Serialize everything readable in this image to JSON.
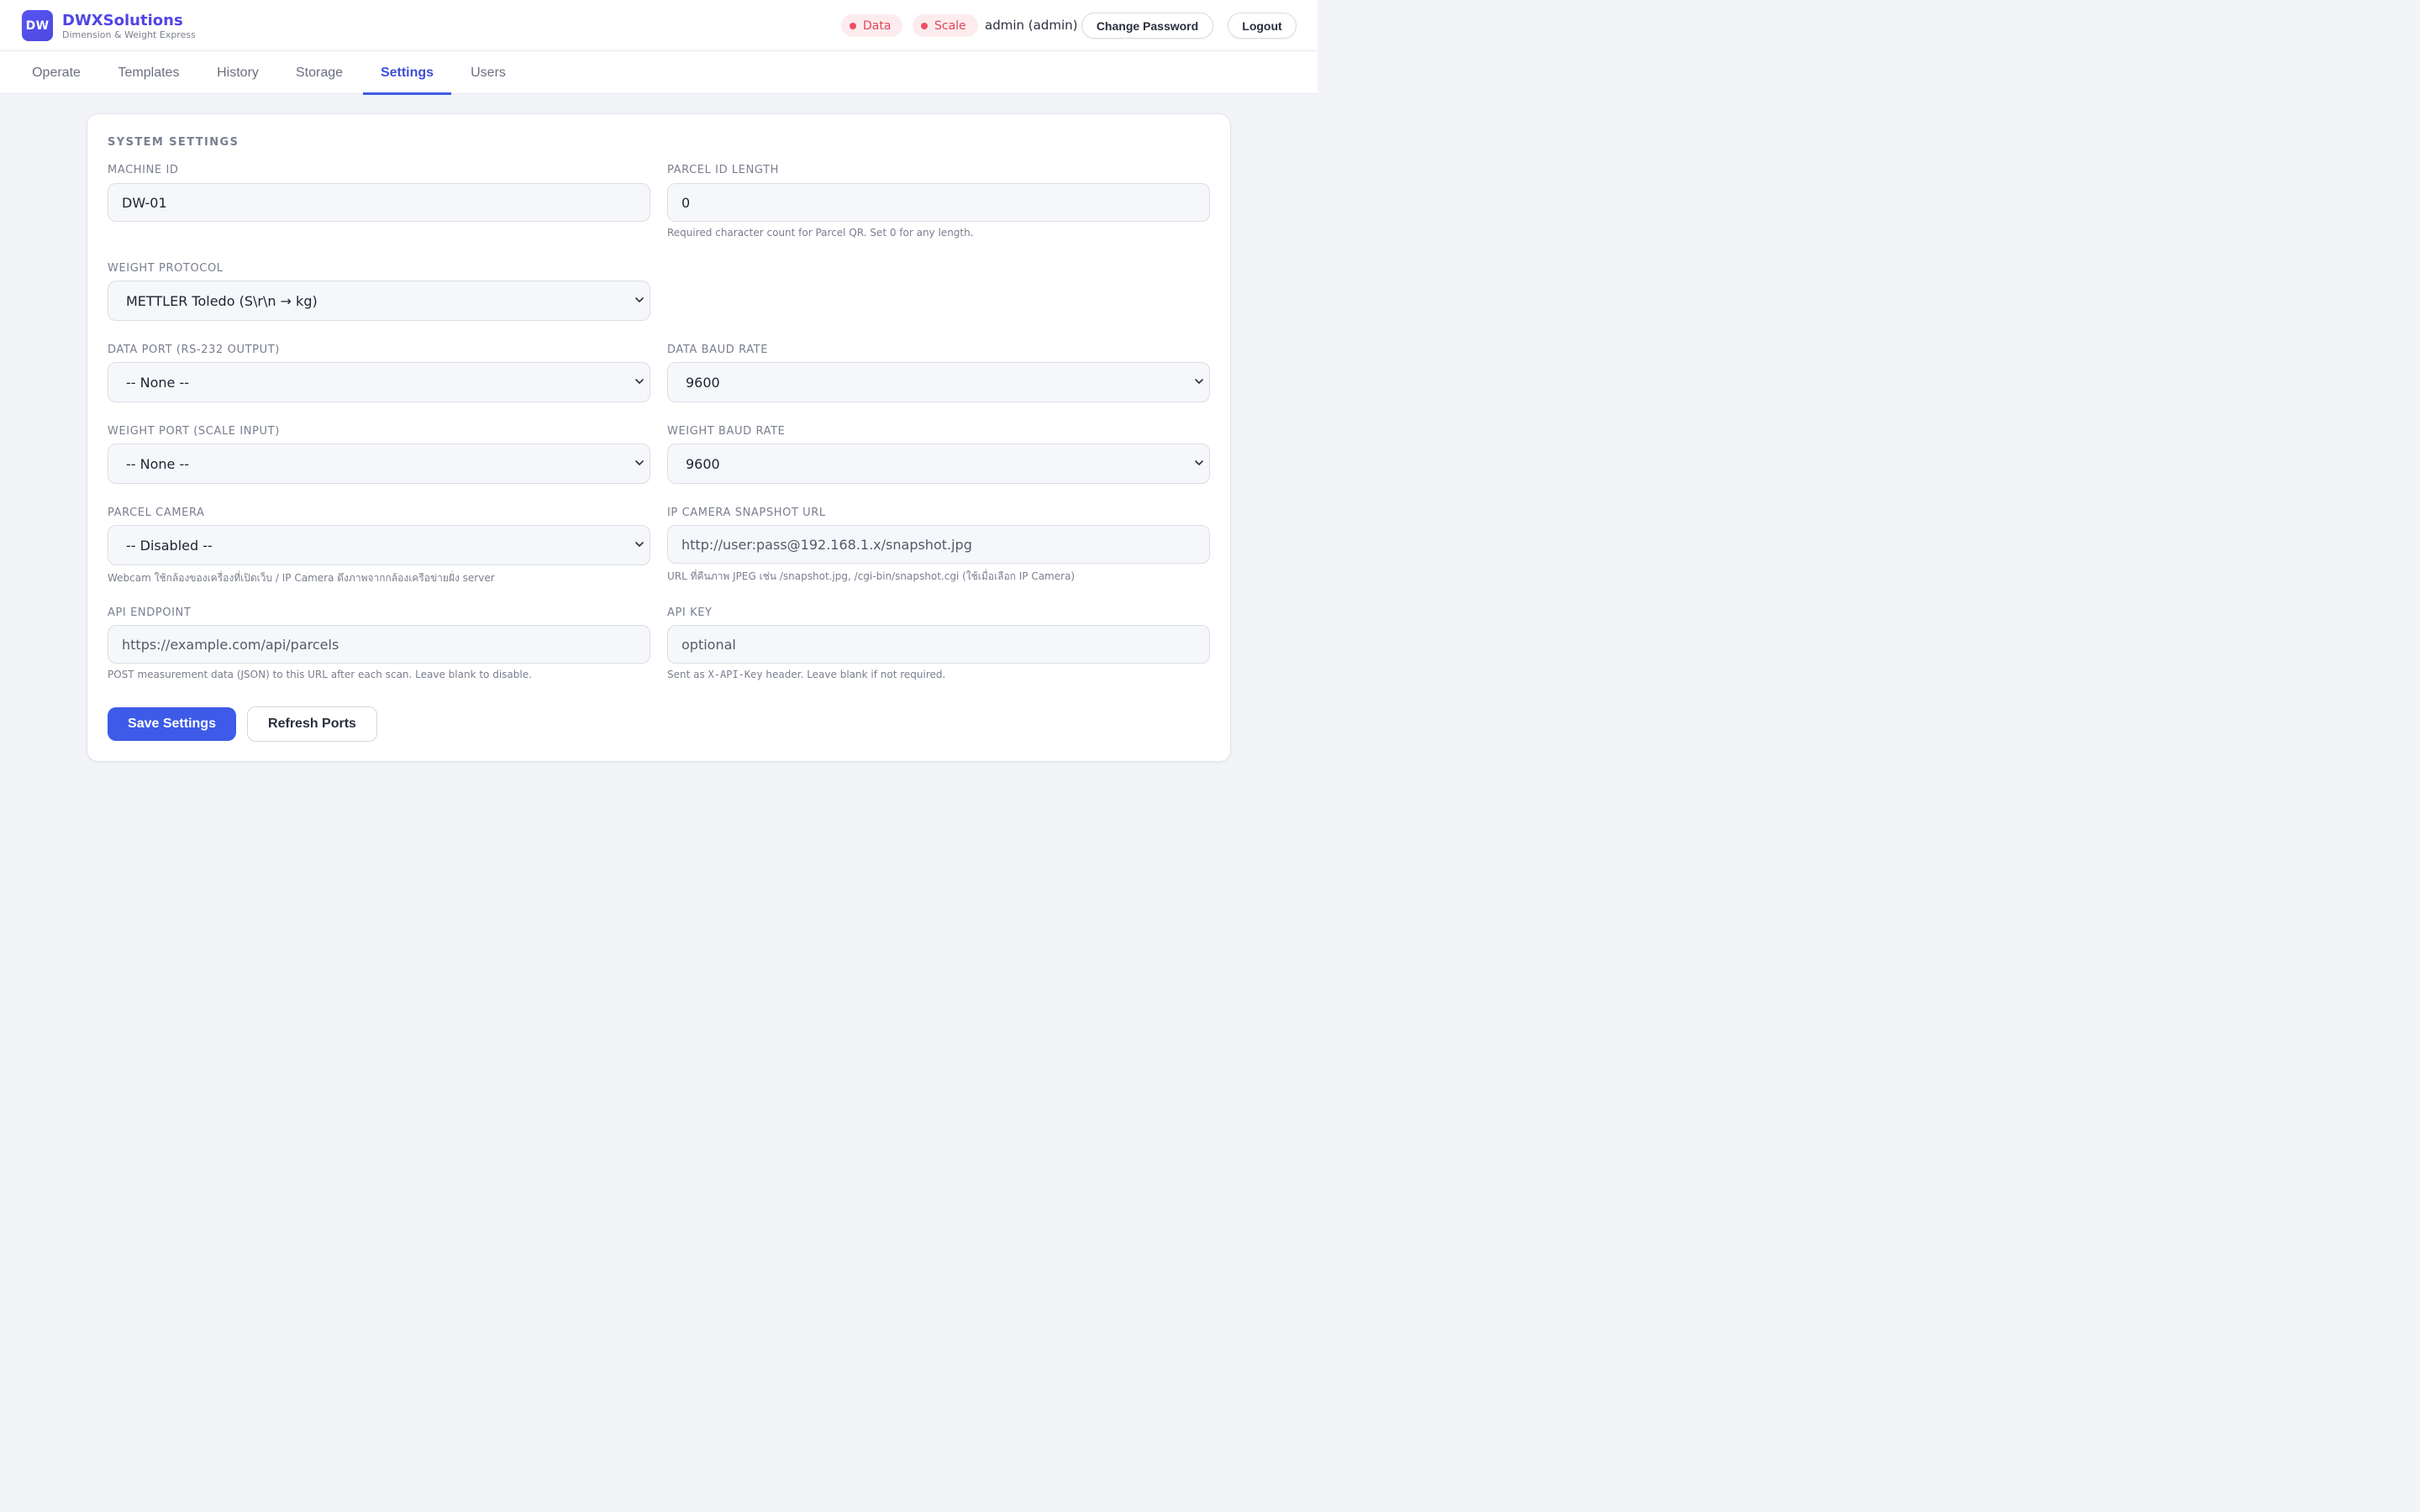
{
  "header": {
    "logo_text": "DW",
    "brand_name": "DWXSolutions",
    "brand_tagline": "Dimension & Weight Express",
    "status_data": "Data",
    "status_scale": "Scale",
    "user": "admin (admin)",
    "change_password": "Change Password",
    "logout": "Logout",
    "status_color": "#ef4e63",
    "accent": "#3d5be8"
  },
  "tabs": [
    {
      "label": "Operate"
    },
    {
      "label": "Templates"
    },
    {
      "label": "History"
    },
    {
      "label": "Storage"
    },
    {
      "label": "Settings",
      "active": true
    },
    {
      "label": "Users"
    }
  ],
  "settings": {
    "section_title": "SYSTEM SETTINGS",
    "machine_id": {
      "label": "MACHINE ID",
      "value": "DW-01"
    },
    "parcel_id_length": {
      "label": "PARCEL ID LENGTH",
      "value": "0",
      "hint": "Required character count for Parcel QR. Set 0 for any length."
    },
    "weight_protocol": {
      "label": "WEIGHT PROTOCOL",
      "value": "METTLER Toledo (S\\r\\n → kg)"
    },
    "data_port": {
      "label": "DATA PORT (RS-232 OUTPUT)",
      "value": "-- None --"
    },
    "data_baud": {
      "label": "DATA BAUD RATE",
      "value": "9600"
    },
    "weight_port": {
      "label": "WEIGHT PORT (SCALE INPUT)",
      "value": "-- None --"
    },
    "weight_baud": {
      "label": "WEIGHT BAUD RATE",
      "value": "9600"
    },
    "parcel_camera": {
      "label": "PARCEL CAMERA",
      "value": "-- Disabled --",
      "hint": "Webcam ใช้กล้องของเครื่องที่เปิดเว็บ / IP Camera ดึงภาพจากกล้องเครือข่ายฝั่ง server"
    },
    "ip_camera_url": {
      "label": "IP CAMERA SNAPSHOT URL",
      "placeholder": "http://user:pass@192.168.1.x/snapshot.jpg",
      "hint": "URL ที่คืนภาพ JPEG เช่น /snapshot.jpg, /cgi-bin/snapshot.cgi (ใช้เมื่อเลือก IP Camera)"
    },
    "api_endpoint": {
      "label": "API ENDPOINT",
      "placeholder": "https://example.com/api/parcels",
      "hint": "POST measurement data (JSON) to this URL after each scan. Leave blank to disable."
    },
    "api_key": {
      "label": "API KEY",
      "placeholder": "optional",
      "hint_prefix": "Sent as ",
      "hint_code": "X-API-Key",
      "hint_suffix": " header. Leave blank if not required."
    },
    "save_button": "Save Settings",
    "refresh_button": "Refresh Ports"
  }
}
